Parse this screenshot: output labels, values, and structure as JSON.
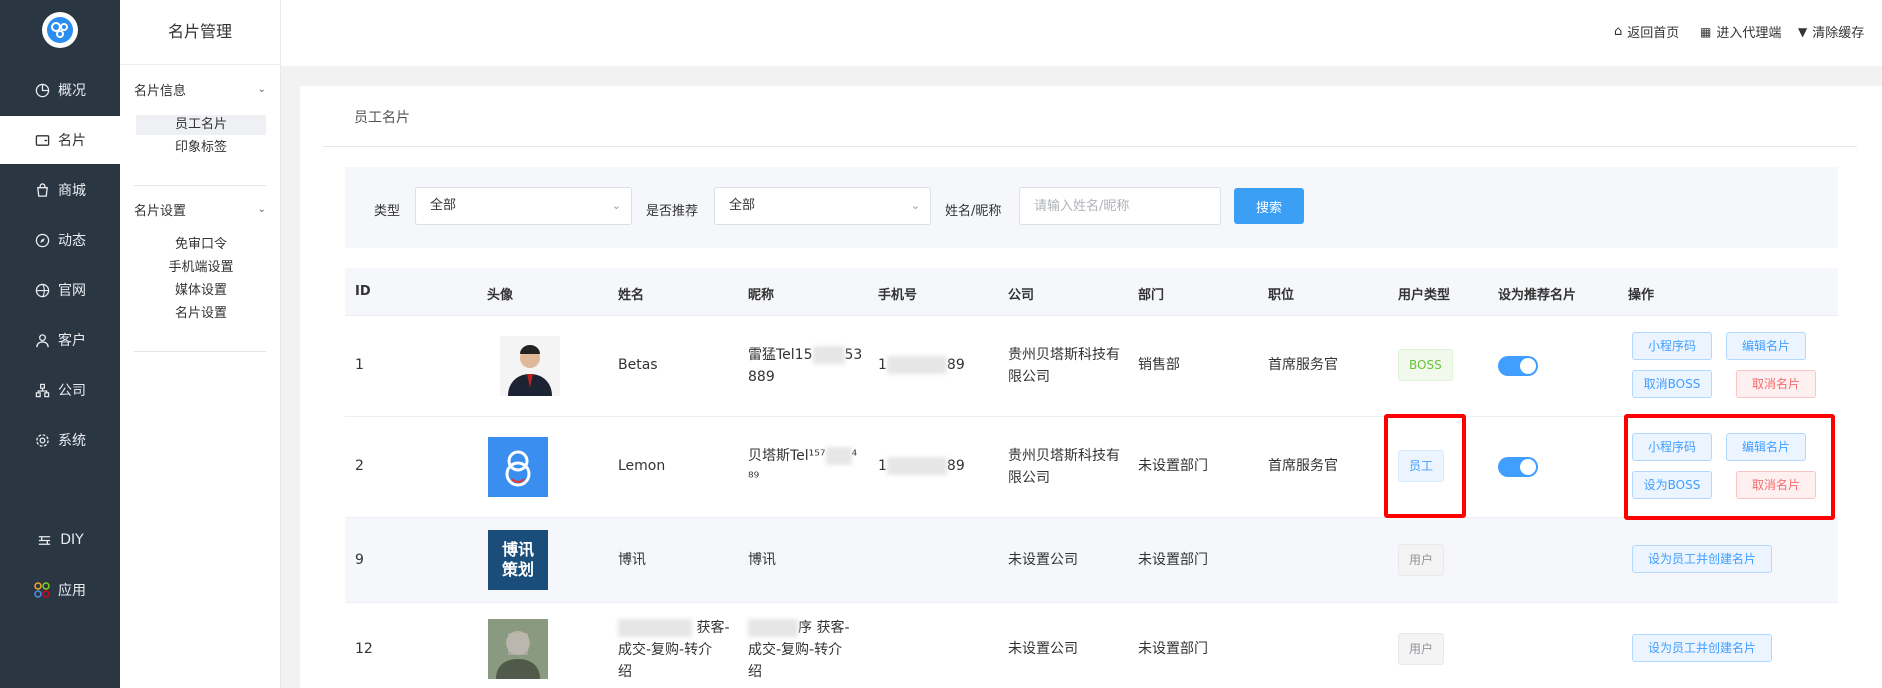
{
  "nav": {
    "items": [
      {
        "label": "概况",
        "icon": "pie-chart-icon"
      },
      {
        "label": "名片",
        "icon": "card-icon"
      },
      {
        "label": "商城",
        "icon": "shop-bag-icon"
      },
      {
        "label": "动态",
        "icon": "compass-icon"
      },
      {
        "label": "官网",
        "icon": "globe-icon"
      },
      {
        "label": "客户",
        "icon": "user-icon"
      },
      {
        "label": "公司",
        "icon": "org-chart-icon"
      },
      {
        "label": "系统",
        "icon": "gear-icon"
      },
      {
        "label": "DIY",
        "icon": "diy-icon"
      },
      {
        "label": "应用",
        "icon": "apps-icon"
      }
    ],
    "active": "名片"
  },
  "sub": {
    "title": "名片管理",
    "group1": "名片信息",
    "group1_items": [
      "员工名片",
      "印象标签"
    ],
    "group2": "名片设置",
    "group2_items": [
      "免审口令",
      "手机端设置",
      "媒体设置",
      "名片设置"
    ]
  },
  "topbar": {
    "home": "返回首页",
    "agent": "进入代理端",
    "cache": "清除缓存"
  },
  "page": {
    "breadcrumb": "员工名片"
  },
  "filter": {
    "type_label": "类型",
    "type_value": "全部",
    "recommend_label": "是否推荐",
    "recommend_value": "全部",
    "name_label": "姓名/昵称",
    "name_placeholder": "请输入姓名/昵称",
    "search_label": "搜索"
  },
  "table": {
    "headers": [
      "ID",
      "头像",
      "姓名",
      "昵称",
      "手机号",
      "公司",
      "部门",
      "职位",
      "用户类型",
      "设为推荐名片",
      "操作"
    ],
    "rows": [
      {
        "id": "1",
        "name": "Betas",
        "nick_a": "雷猛Tel15",
        "nick_b": "53",
        "nick_c": "889",
        "phone_a": "1",
        "phone_b": "89",
        "company": "贵州贝塔斯科技有限公司",
        "dept": "销售部",
        "position": "首席服务官",
        "type": "BOSS",
        "recommended": true,
        "actions": [
          "小程序码",
          "编辑名片",
          "取消BOSS",
          "取消名片"
        ]
      },
      {
        "id": "2",
        "name": "Lemon",
        "nick_a": "贝塔斯Tel¹⁵⁷",
        "nick_b": "⁴",
        "nick_c": "⁸⁹",
        "phone_a": "1",
        "phone_b": "89",
        "company": "贵州贝塔斯科技有限公司",
        "dept": "未设置部门",
        "position": "首席服务官",
        "type": "员工",
        "recommended": true,
        "actions": [
          "小程序码",
          "编辑名片",
          "设为BOSS",
          "取消名片"
        ]
      },
      {
        "id": "9",
        "name": "博讯",
        "nick": "博讯",
        "company": "未设置公司",
        "dept": "未设置部门",
        "type": "用户",
        "avatar_line1": "博讯",
        "avatar_line2": "策划",
        "actions": [
          "设为员工并创建名片"
        ]
      },
      {
        "id": "12",
        "name_a": "获客-",
        "name_b": "成交-复购-转介",
        "name_c": "绍",
        "nick_a": "序 获客-",
        "nick_b": "成交-复购-转介",
        "nick_c": "绍",
        "company": "未设置公司",
        "dept": "未设置部门",
        "type": "用户",
        "actions": [
          "设为员工并创建名片"
        ]
      }
    ]
  },
  "colors": {
    "nav_bg": "#2b3643",
    "accent": "#409eff",
    "highlight": "#ff0000"
  }
}
